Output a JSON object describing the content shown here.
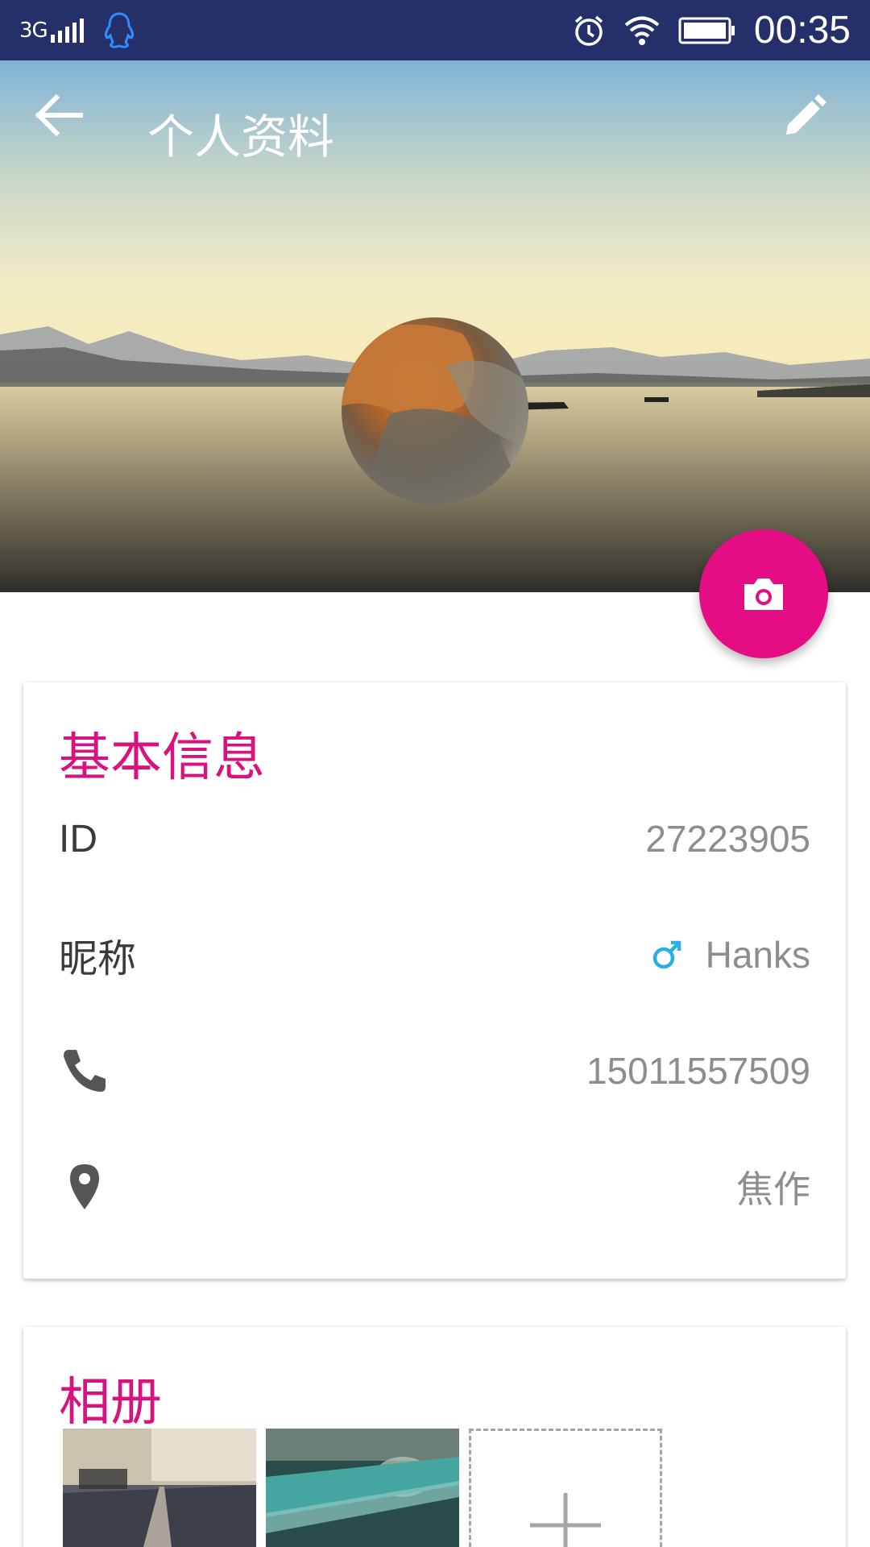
{
  "status_bar": {
    "network": "3G",
    "time": "00:35",
    "colors": {
      "background": "#25306a"
    }
  },
  "header": {
    "title": "个人资料",
    "icons": {
      "back": "arrow-left-icon",
      "edit": "pencil-icon",
      "camera": "camera-icon"
    },
    "accent": "#e40d83"
  },
  "basic_info": {
    "title": "基本信息",
    "rows": [
      {
        "label": "ID",
        "value": "27223905"
      },
      {
        "label": "昵称",
        "value": "Hanks",
        "icon": "male-icon"
      },
      {
        "label": "",
        "value": "15011557509",
        "icon": "phone-icon"
      },
      {
        "label": "",
        "value": "焦作",
        "icon": "location-pin-icon"
      }
    ]
  },
  "album": {
    "title": "相册",
    "add_icon": "plus-icon"
  }
}
